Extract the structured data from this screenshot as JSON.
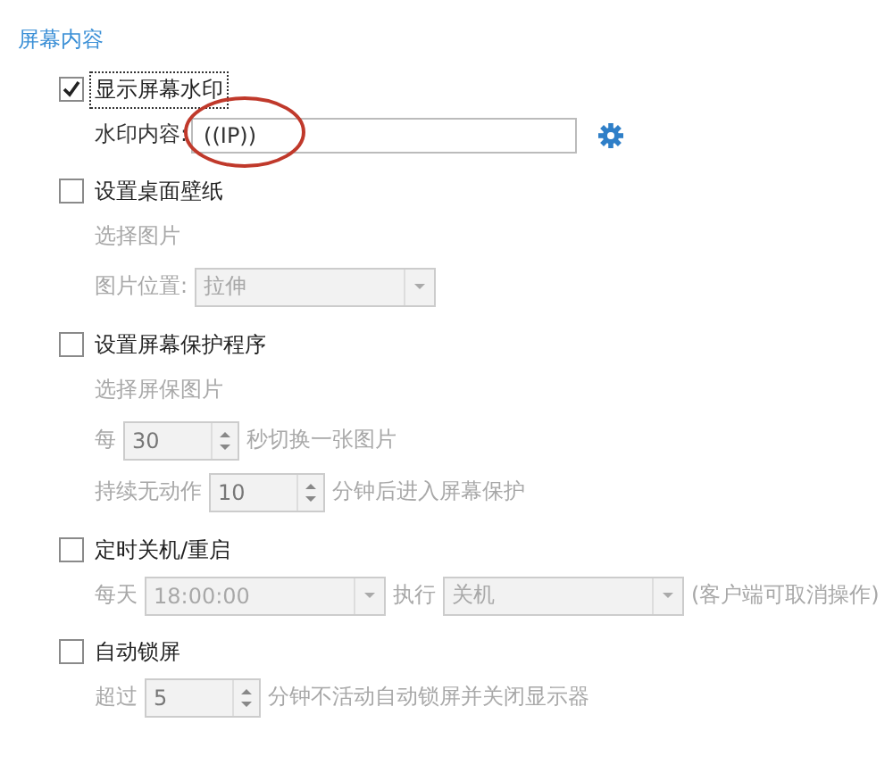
{
  "section_title": "屏幕内容",
  "groups": [
    {
      "label": "显示屏幕水印",
      "checked": true,
      "rows": [
        {
          "items": [
            {
              "kind": "text",
              "text": "水印内容:"
            },
            {
              "kind": "input",
              "value": "((IP))",
              "circled": true
            },
            {
              "kind": "gear"
            }
          ]
        }
      ]
    },
    {
      "label": "设置桌面壁纸",
      "checked": false,
      "rows": [
        {
          "items": [
            {
              "kind": "text",
              "text": "选择图片"
            }
          ]
        },
        {
          "items": [
            {
              "kind": "text",
              "text": "图片位置:"
            },
            {
              "kind": "select",
              "value": "拉伸"
            }
          ]
        }
      ]
    },
    {
      "label": "设置屏幕保护程序",
      "checked": false,
      "rows": [
        {
          "items": [
            {
              "kind": "text",
              "text": "选择屏保图片"
            }
          ]
        },
        {
          "items": [
            {
              "kind": "text",
              "text": "每"
            },
            {
              "kind": "spin",
              "value": "30"
            },
            {
              "kind": "text",
              "text": "秒切换一张图片"
            }
          ]
        },
        {
          "items": [
            {
              "kind": "text",
              "text": "持续无动作"
            },
            {
              "kind": "spin",
              "value": "10"
            },
            {
              "kind": "text",
              "text": "分钟后进入屏幕保护"
            }
          ]
        }
      ]
    },
    {
      "label": "定时关机/重启",
      "checked": false,
      "rows": [
        {
          "items": [
            {
              "kind": "text",
              "text": "每天"
            },
            {
              "kind": "select",
              "value": "18:00:00"
            },
            {
              "kind": "text",
              "text": "执行"
            },
            {
              "kind": "select",
              "value": "关机"
            },
            {
              "kind": "text",
              "text": "(客户端可取消操作)"
            }
          ]
        }
      ]
    },
    {
      "label": "自动锁屏",
      "checked": false,
      "rows": [
        {
          "items": [
            {
              "kind": "text",
              "text": "超过"
            },
            {
              "kind": "spin",
              "value": "5"
            },
            {
              "kind": "text",
              "text": "分钟不活动自动锁屏并关闭显示器"
            }
          ]
        }
      ]
    }
  ]
}
